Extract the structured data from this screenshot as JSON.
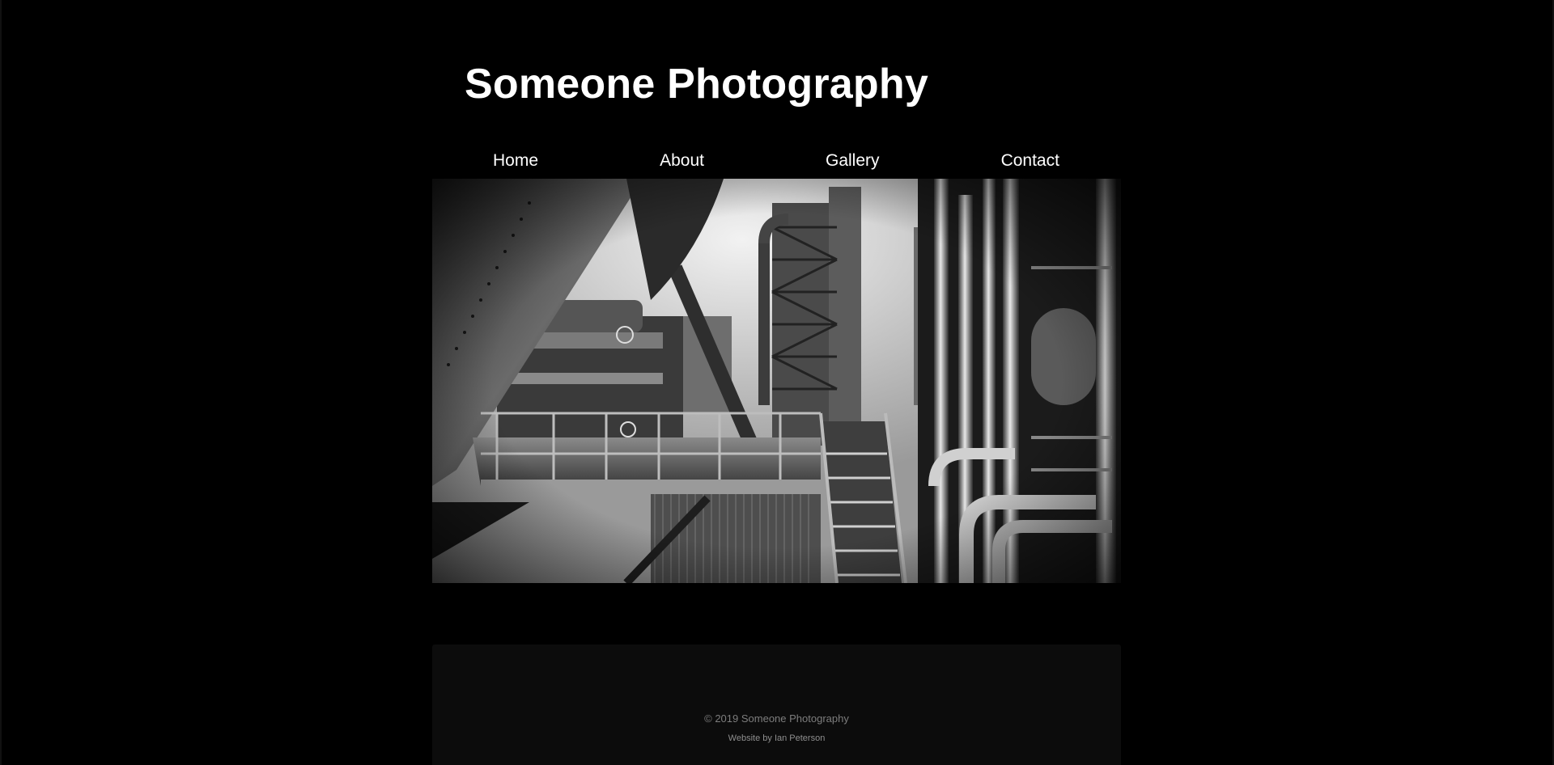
{
  "header": {
    "title": "Someone Photography"
  },
  "nav": {
    "items": [
      {
        "label": "Home"
      },
      {
        "label": "About"
      },
      {
        "label": "Gallery"
      },
      {
        "label": "Contact"
      }
    ]
  },
  "footer": {
    "copyright": "© 2019 Someone Photography",
    "credit": "Website by Ian Peterson"
  },
  "colors": {
    "background": "#000000",
    "text": "#ffffff",
    "footer_bg": "#0c0c0c",
    "footer_text": "#7d7d7d"
  }
}
